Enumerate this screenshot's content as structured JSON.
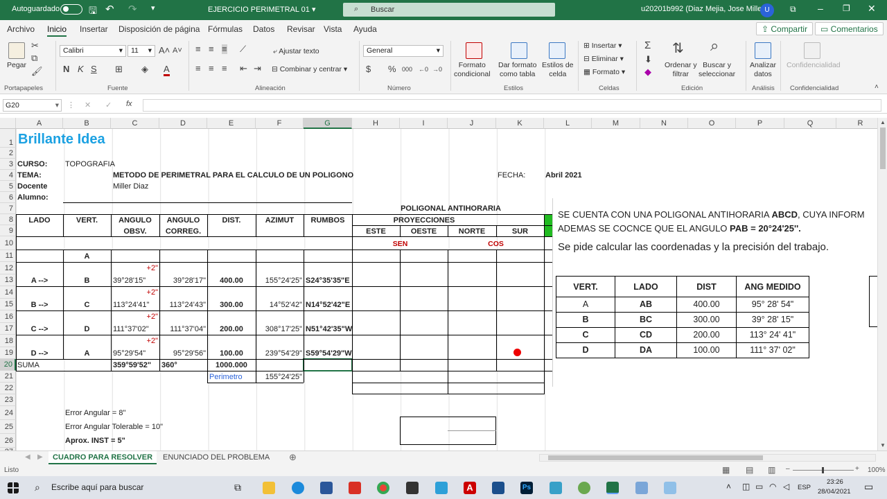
{
  "titlebar": {
    "autosave_label": "Autoguardado",
    "doc_title": "EJERCICIO PERIMETRAL 01",
    "search_placeholder": "Buscar",
    "user_name": "u20201b992 (Diaz Mejia, Jose  Miller)",
    "avatar_initial": "U"
  },
  "menu": {
    "items": [
      "Archivo",
      "Inicio",
      "Insertar",
      "Disposición de página",
      "Fórmulas",
      "Datos",
      "Revisar",
      "Vista",
      "Ayuda"
    ],
    "share": "Compartir",
    "comments": "Comentarios"
  },
  "ribbon": {
    "paste": "Pegar",
    "font_name": "Calibri",
    "font_size": "11",
    "wrap_text": "Ajustar texto",
    "merge_center": "Combinar y centrar",
    "number_format": "General",
    "cond_format": "Formato\ncondicional",
    "format_table": "Dar formato\ncomo tabla",
    "cell_styles": "Estilos de\ncelda",
    "insert": "Insertar",
    "delete": "Eliminar",
    "format": "Formato",
    "sort_filter": "Ordenar y\nfiltrar",
    "find_select": "Buscar y\nseleccionar",
    "analyze": "Analizar\ndatos",
    "confidential": "Confidencialidad",
    "groups": [
      "Portapapeles",
      "Fuente",
      "Alineación",
      "Número",
      "Estilos",
      "Celdas",
      "Edición",
      "Análisis",
      "Confidencialidad"
    ]
  },
  "formula_bar": {
    "name_box": "G20",
    "fx": "fx",
    "content": ""
  },
  "columns": [
    "A",
    "B",
    "C",
    "D",
    "E",
    "F",
    "G",
    "H",
    "I",
    "J",
    "K",
    "L",
    "M",
    "N",
    "O",
    "P",
    "Q",
    "R"
  ],
  "rows": [
    "1",
    "2",
    "3",
    "4",
    "5",
    "6",
    "7",
    "8",
    "9",
    "10",
    "11",
    "12",
    "13",
    "14",
    "15",
    "16",
    "17",
    "18",
    "19",
    "20",
    "21",
    "22",
    "23",
    "24",
    "25",
    "26",
    "27"
  ],
  "sheet": {
    "brand": "Brillante Idea",
    "curso_label": "CURSO:",
    "curso": "TOPOGRAFIA",
    "tema_label": "TEMA:",
    "tema": "METODO DE PERIMETRAL PARA EL CALCULO DE UN POLIGONO",
    "fecha_label": "FECHA:",
    "fecha": "Abril 2021",
    "docente_label": "Docente",
    "docente": "Miller Diaz",
    "alumno_label": "Alumno:",
    "poligonal": "POLIGONAL ANTIHORARIA",
    "headers": {
      "lado": "LADO",
      "vert": "VERT.",
      "ang_obs_1": "ANGULO",
      "ang_obs_2": "OBSV.",
      "ang_cor_1": "ANGULO",
      "ang_cor_2": "CORREG.",
      "dist": "DIST.",
      "azimut": "AZIMUT",
      "rumbos": "RUMBOS",
      "proyecciones": "PROYECCIONES",
      "este": "ESTE",
      "oeste": "OESTE",
      "norte": "NORTE",
      "sur": "SUR",
      "sen": "SEN",
      "cos": "COS"
    },
    "vertex_first": "A",
    "rows": [
      {
        "corr": "+2\"",
        "lado": "A -->",
        "vert": "B",
        "obs": "39°28'15\"",
        "cor": "39°28'17\"",
        "dist": "400.00",
        "az": "155°24'25\"",
        "rumbo": "S24°35'35\"E"
      },
      {
        "corr": "+2\"",
        "lado": "B -->",
        "vert": "C",
        "obs": "113°24'41\"",
        "cor": "113°24'43\"",
        "dist": "300.00",
        "az": "14°52'42\"",
        "rumbo": "N14°52'42\"E"
      },
      {
        "corr": "+2\"",
        "lado": "C -->",
        "vert": "D",
        "obs": "111°37'02\"",
        "cor": "111°37'04\"",
        "dist": "200.00",
        "az": "308°17'25\"",
        "rumbo": "N51°42'35\"W"
      },
      {
        "corr": "+2\"",
        "lado": "D -->",
        "vert": "A",
        "obs": "95°29'54\"",
        "cor": "95°29'56\"",
        "dist": "100.00",
        "az": "239°54'29\"",
        "rumbo": "S59°54'29\"W"
      }
    ],
    "suma_label": "SUMA",
    "suma_obs": "359°59'52\"",
    "suma_cor": "360°",
    "suma_dist": "1000.000",
    "perimetro_label": "Perimetro",
    "perimetro_az": "155°24'25\"",
    "error_angular": "Error Angular = 8\"",
    "error_tolerable": "Error Angular Tolerable = 10\"",
    "aprox_inst": "Aprox. INST = 5\""
  },
  "problem": {
    "line1_a": "SE CUENTA CON UNA POLIGONAL ANTIHORARIA ",
    "line1_b": "ABCD",
    "line1_c": ", CUYA INFORM",
    "line2_a": "ADEMAS  SE COCNCE QUE EL ANGULO ",
    "line2_b": "PAB = 20°24'25''.",
    "line3": "Se pide calcular las coordenadas y la precisión del trabajo.",
    "table_headers": [
      "VERT.",
      "LADO",
      "DIST",
      "ANG MEDIDO"
    ],
    "table_rows": [
      [
        "A",
        "AB",
        "400.00",
        "95° 28' 54\""
      ],
      [
        "B",
        "BC",
        "300.00",
        "39° 28' 15\""
      ],
      [
        "C",
        "CD",
        "200.00",
        "113° 24' 41\""
      ],
      [
        "D",
        "DA",
        "100.00",
        "111° 37' 02\""
      ]
    ]
  },
  "tabs": {
    "active": "CUADRO PARA RESOLVER",
    "other": "ENUNCIADO DEL PROBLEMA"
  },
  "status": {
    "left": "Listo",
    "zoom": "100%"
  },
  "taskbar": {
    "search": "Escribe aquí para buscar",
    "lang": "ESP",
    "time": "23:26",
    "date": "28/04/2021"
  },
  "colors": {
    "excel_green": "#217346",
    "accent_red": "#c00000",
    "brand_blue": "#1ba1e2"
  }
}
